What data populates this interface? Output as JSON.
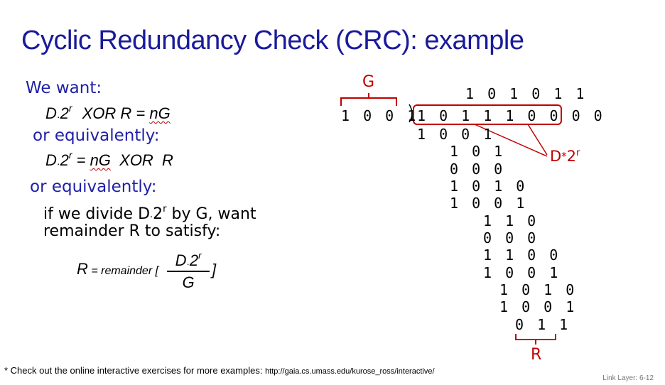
{
  "title": "Cyclic Redundancy Check (CRC): example",
  "left": {
    "we_want": "We want:",
    "eq1": {
      "d": "D",
      "dot": "·",
      "two": "2",
      "r": "r",
      "rest_a": "XOR  R = ",
      "ng": "nG"
    },
    "or_equiv_1": "or equivalently:",
    "eq2": {
      "d": "D",
      "dot": "·",
      "two": "2",
      "r": "r",
      "rest_a": " = ",
      "ng": "nG",
      "rest_b": "  XOR  R"
    },
    "or_equiv_2": "or equivalently:",
    "divide_line1_a": "if we divide D",
    "divide_dot": "·",
    "divide_two": "2",
    "divide_r": "r",
    "divide_line1_b": " by G, want",
    "divide_line2": "remainder R to satisfy:",
    "formula": {
      "r": "R",
      "eq": " = remainder [",
      "num_d": "D",
      "num_dot": "·",
      "num_two": "2",
      "num_r": "r",
      "den": "G",
      "close": "]"
    }
  },
  "division": {
    "g_label": "G",
    "divisor": "1 0 0 1",
    "quotient": "1 0 1 0 1 1",
    "dividend": "1 0 1 1 1 0 0 0 0",
    "rows": [
      "1 0 0 1",
      "1 0 1",
      "0 0 0",
      "1 0 1 0",
      "1 0 0 1",
      "1 1 0",
      "0 0 0",
      "1 1 0 0",
      "1 0 0 1",
      "1 0 1 0",
      "1 0 0 1",
      "0 1 1"
    ],
    "d2r_label_d": "D",
    "d2r_label_star": "*",
    "d2r_label_two": "2",
    "d2r_label_r": "r",
    "r_label": "R"
  },
  "footnote": {
    "text": "* Check out the online interactive exercises for more examples: ",
    "url": "http://gaia.cs.umass.edu/kurose_ross/interactive/"
  },
  "slide_label": "Link Layer: 6-12"
}
